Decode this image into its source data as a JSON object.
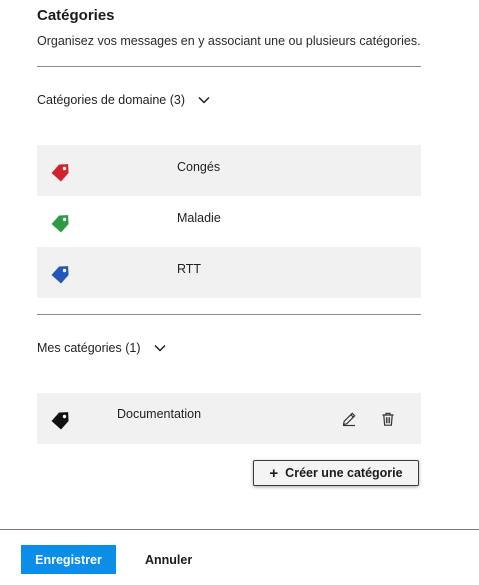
{
  "header": {
    "title": "Catégories",
    "description": "Organisez vos messages en y associant une ou plusieurs catégories."
  },
  "domain_section": {
    "toggle_label": "Catégories de domaine (3)",
    "items": [
      {
        "label": "Congés",
        "color": "#d1232e",
        "icon": "tag-icon"
      },
      {
        "label": "Maladie",
        "color": "#2e9a45",
        "icon": "tag-icon"
      },
      {
        "label": "RTT",
        "color": "#2458b8",
        "icon": "tag-icon"
      }
    ]
  },
  "my_section": {
    "toggle_label": "Mes catégories (1)",
    "items": [
      {
        "label": "Documentation",
        "color": "#111111",
        "icon": "tag-icon",
        "actions": [
          "edit-icon",
          "trash-icon"
        ]
      }
    ]
  },
  "create_button": {
    "label": "Créer une catégorie",
    "icon": "plus-icon"
  },
  "footer": {
    "save_label": "Enregistrer",
    "cancel_label": "Annuler",
    "accent_color": "#0a8ee8"
  }
}
